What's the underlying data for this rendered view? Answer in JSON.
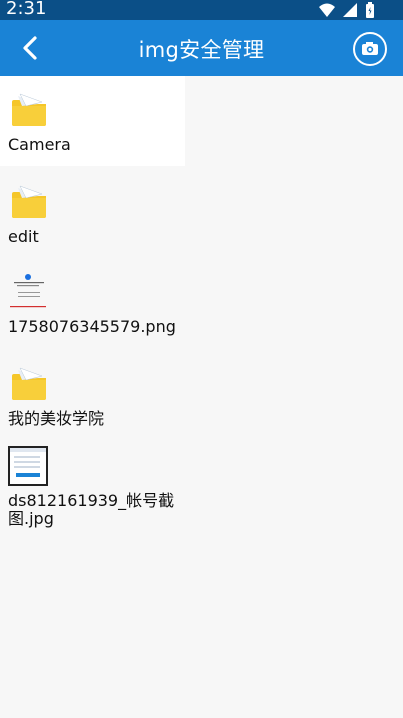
{
  "status_bar": {
    "time": "2:31"
  },
  "app_bar": {
    "title": "img安全管理"
  },
  "items": [
    {
      "label": "Camera",
      "type": "folder",
      "selected": true
    },
    {
      "label": "edit",
      "type": "folder"
    },
    {
      "label": "1758076345579.png",
      "type": "image"
    },
    {
      "label": "我的美妆学院",
      "type": "folder"
    },
    {
      "label": "ds812161939_帐号截图.jpg",
      "type": "image"
    }
  ],
  "colors": {
    "appbar": "#1a83d6",
    "statusbar": "#0b4f87",
    "folder": "#f5c629"
  }
}
